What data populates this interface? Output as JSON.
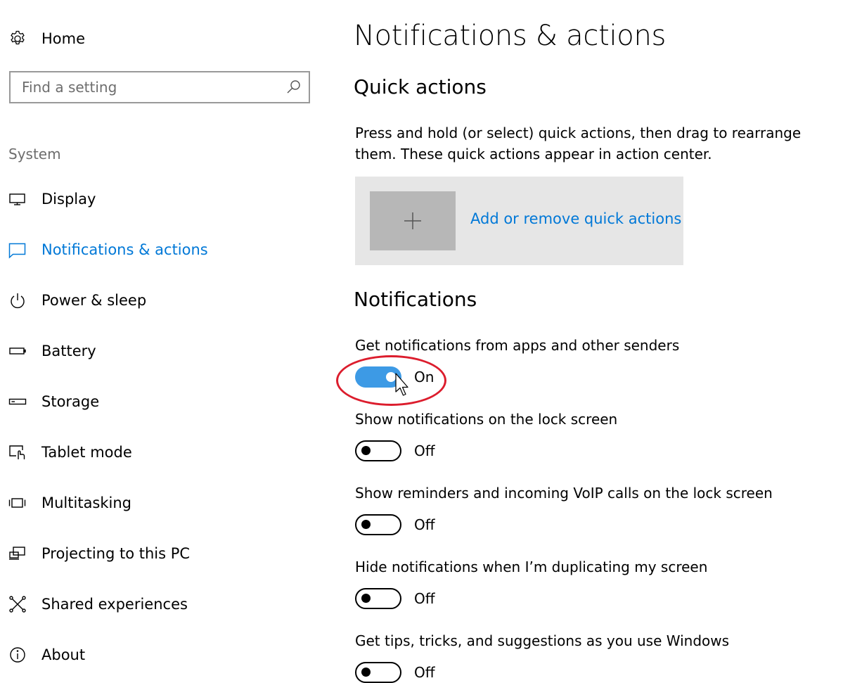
{
  "sidebar": {
    "home_label": "Home",
    "search_placeholder": "Find a setting",
    "section_label": "System",
    "items": [
      {
        "label": "Display",
        "icon": "display-icon",
        "active": false
      },
      {
        "label": "Notifications & actions",
        "icon": "notifications-icon",
        "active": true
      },
      {
        "label": "Power & sleep",
        "icon": "power-icon",
        "active": false
      },
      {
        "label": "Battery",
        "icon": "battery-icon",
        "active": false
      },
      {
        "label": "Storage",
        "icon": "storage-icon",
        "active": false
      },
      {
        "label": "Tablet mode",
        "icon": "tablet-mode-icon",
        "active": false
      },
      {
        "label": "Multitasking",
        "icon": "multitasking-icon",
        "active": false
      },
      {
        "label": "Projecting to this PC",
        "icon": "projecting-icon",
        "active": false
      },
      {
        "label": "Shared experiences",
        "icon": "shared-experiences-icon",
        "active": false
      },
      {
        "label": "About",
        "icon": "info-icon",
        "active": false
      }
    ]
  },
  "main": {
    "title": "Notifications & actions",
    "quick_actions": {
      "heading": "Quick actions",
      "description": "Press and hold (or select) quick actions, then drag to rearrange them. These quick actions appear in action center.",
      "add_link": "Add or remove quick actions"
    },
    "notifications": {
      "heading": "Notifications",
      "settings": [
        {
          "label": "Get notifications from apps and other senders",
          "state": "On",
          "on": true
        },
        {
          "label": "Show notifications on the lock screen",
          "state": "Off",
          "on": false
        },
        {
          "label": "Show reminders and incoming VoIP calls on the lock screen",
          "state": "Off",
          "on": false
        },
        {
          "label": "Hide notifications when I’m duplicating my screen",
          "state": "Off",
          "on": false
        },
        {
          "label": "Get tips, tricks, and suggestions as you use Windows",
          "state": "Off",
          "on": false
        }
      ]
    }
  },
  "colors": {
    "accent": "#0078d7",
    "toggle_on": "#3d9ae5",
    "highlight": "#dc1d2d",
    "quick_action_panel": "#e6e6e6",
    "quick_action_tile": "#b7b7b7"
  }
}
